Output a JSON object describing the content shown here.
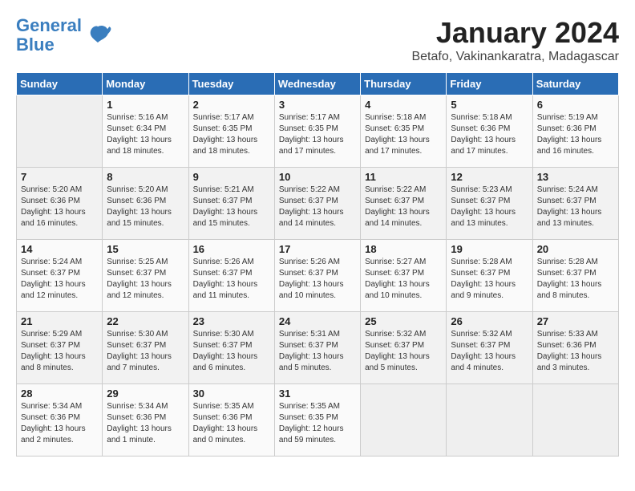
{
  "header": {
    "logo_line1": "General",
    "logo_line2": "Blue",
    "title": "January 2024",
    "subtitle": "Betafo, Vakinankaratra, Madagascar"
  },
  "weekdays": [
    "Sunday",
    "Monday",
    "Tuesday",
    "Wednesday",
    "Thursday",
    "Friday",
    "Saturday"
  ],
  "weeks": [
    [
      {
        "day": "",
        "empty": true
      },
      {
        "day": "1",
        "sunrise": "5:16 AM",
        "sunset": "6:34 PM",
        "daylight": "13 hours and 18 minutes."
      },
      {
        "day": "2",
        "sunrise": "5:17 AM",
        "sunset": "6:35 PM",
        "daylight": "13 hours and 18 minutes."
      },
      {
        "day": "3",
        "sunrise": "5:17 AM",
        "sunset": "6:35 PM",
        "daylight": "13 hours and 17 minutes."
      },
      {
        "day": "4",
        "sunrise": "5:18 AM",
        "sunset": "6:35 PM",
        "daylight": "13 hours and 17 minutes."
      },
      {
        "day": "5",
        "sunrise": "5:18 AM",
        "sunset": "6:36 PM",
        "daylight": "13 hours and 17 minutes."
      },
      {
        "day": "6",
        "sunrise": "5:19 AM",
        "sunset": "6:36 PM",
        "daylight": "13 hours and 16 minutes."
      }
    ],
    [
      {
        "day": "7",
        "sunrise": "5:20 AM",
        "sunset": "6:36 PM",
        "daylight": "13 hours and 16 minutes."
      },
      {
        "day": "8",
        "sunrise": "5:20 AM",
        "sunset": "6:36 PM",
        "daylight": "13 hours and 15 minutes."
      },
      {
        "day": "9",
        "sunrise": "5:21 AM",
        "sunset": "6:37 PM",
        "daylight": "13 hours and 15 minutes."
      },
      {
        "day": "10",
        "sunrise": "5:22 AM",
        "sunset": "6:37 PM",
        "daylight": "13 hours and 14 minutes."
      },
      {
        "day": "11",
        "sunrise": "5:22 AM",
        "sunset": "6:37 PM",
        "daylight": "13 hours and 14 minutes."
      },
      {
        "day": "12",
        "sunrise": "5:23 AM",
        "sunset": "6:37 PM",
        "daylight": "13 hours and 13 minutes."
      },
      {
        "day": "13",
        "sunrise": "5:24 AM",
        "sunset": "6:37 PM",
        "daylight": "13 hours and 13 minutes."
      }
    ],
    [
      {
        "day": "14",
        "sunrise": "5:24 AM",
        "sunset": "6:37 PM",
        "daylight": "13 hours and 12 minutes."
      },
      {
        "day": "15",
        "sunrise": "5:25 AM",
        "sunset": "6:37 PM",
        "daylight": "13 hours and 12 minutes."
      },
      {
        "day": "16",
        "sunrise": "5:26 AM",
        "sunset": "6:37 PM",
        "daylight": "13 hours and 11 minutes."
      },
      {
        "day": "17",
        "sunrise": "5:26 AM",
        "sunset": "6:37 PM",
        "daylight": "13 hours and 10 minutes."
      },
      {
        "day": "18",
        "sunrise": "5:27 AM",
        "sunset": "6:37 PM",
        "daylight": "13 hours and 10 minutes."
      },
      {
        "day": "19",
        "sunrise": "5:28 AM",
        "sunset": "6:37 PM",
        "daylight": "13 hours and 9 minutes."
      },
      {
        "day": "20",
        "sunrise": "5:28 AM",
        "sunset": "6:37 PM",
        "daylight": "13 hours and 8 minutes."
      }
    ],
    [
      {
        "day": "21",
        "sunrise": "5:29 AM",
        "sunset": "6:37 PM",
        "daylight": "13 hours and 8 minutes."
      },
      {
        "day": "22",
        "sunrise": "5:30 AM",
        "sunset": "6:37 PM",
        "daylight": "13 hours and 7 minutes."
      },
      {
        "day": "23",
        "sunrise": "5:30 AM",
        "sunset": "6:37 PM",
        "daylight": "13 hours and 6 minutes."
      },
      {
        "day": "24",
        "sunrise": "5:31 AM",
        "sunset": "6:37 PM",
        "daylight": "13 hours and 5 minutes."
      },
      {
        "day": "25",
        "sunrise": "5:32 AM",
        "sunset": "6:37 PM",
        "daylight": "13 hours and 5 minutes."
      },
      {
        "day": "26",
        "sunrise": "5:32 AM",
        "sunset": "6:37 PM",
        "daylight": "13 hours and 4 minutes."
      },
      {
        "day": "27",
        "sunrise": "5:33 AM",
        "sunset": "6:36 PM",
        "daylight": "13 hours and 3 minutes."
      }
    ],
    [
      {
        "day": "28",
        "sunrise": "5:34 AM",
        "sunset": "6:36 PM",
        "daylight": "13 hours and 2 minutes."
      },
      {
        "day": "29",
        "sunrise": "5:34 AM",
        "sunset": "6:36 PM",
        "daylight": "13 hours and 1 minute."
      },
      {
        "day": "30",
        "sunrise": "5:35 AM",
        "sunset": "6:36 PM",
        "daylight": "13 hours and 0 minutes."
      },
      {
        "day": "31",
        "sunrise": "5:35 AM",
        "sunset": "6:35 PM",
        "daylight": "12 hours and 59 minutes."
      },
      {
        "day": "",
        "empty": true
      },
      {
        "day": "",
        "empty": true
      },
      {
        "day": "",
        "empty": true
      }
    ]
  ]
}
